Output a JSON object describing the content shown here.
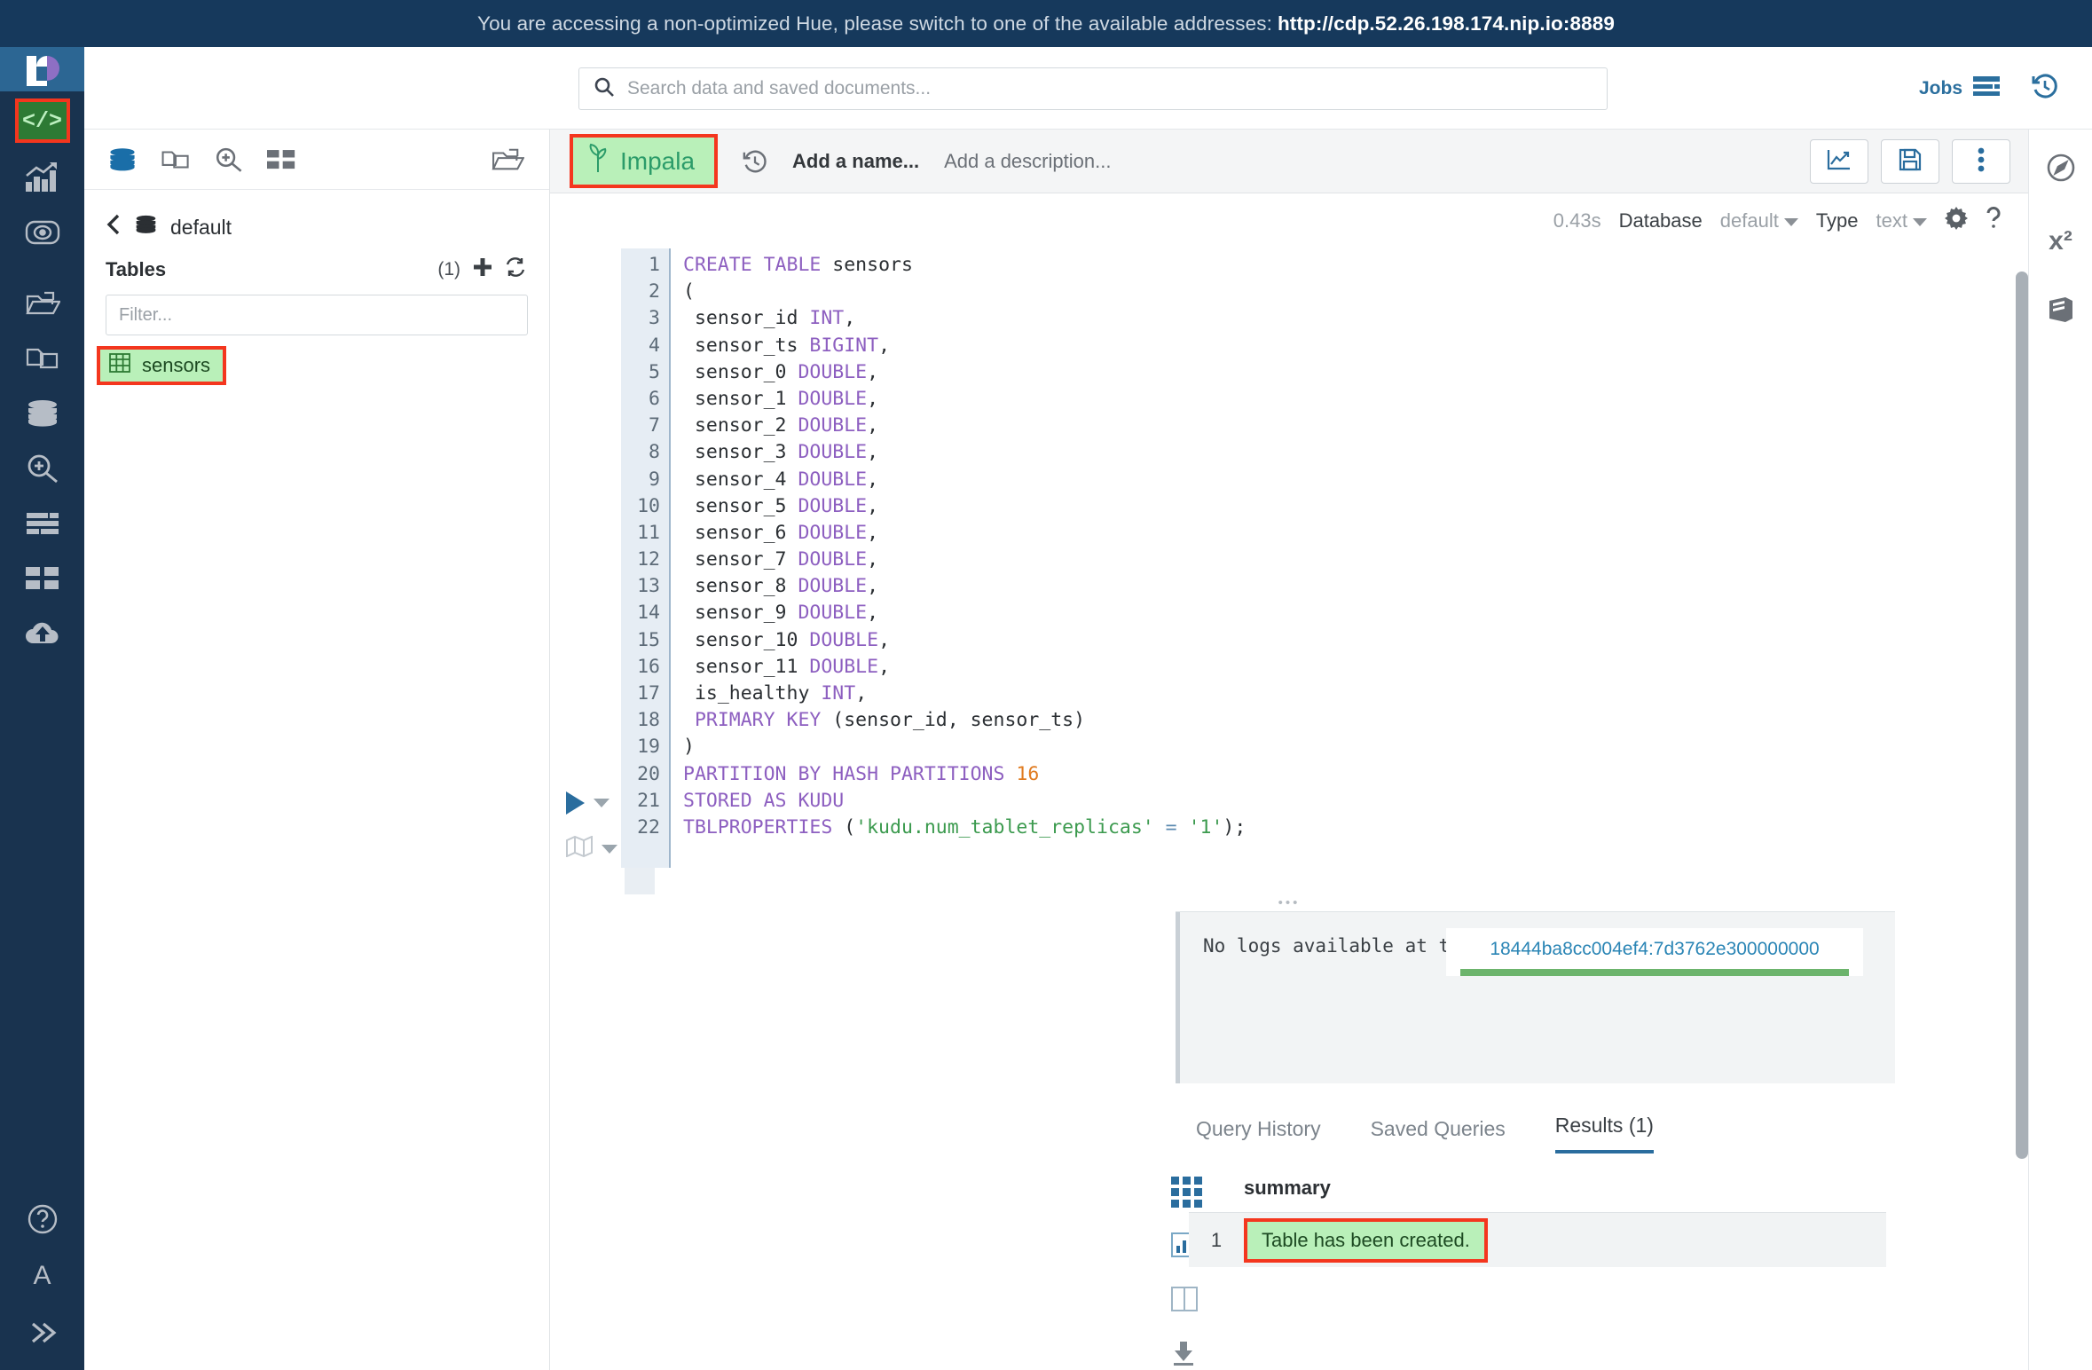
{
  "banner": {
    "message": "You are accessing a non-optimized Hue, please switch to one of the available addresses:",
    "url": "http://cdp.52.26.198.174.nip.io:8889"
  },
  "left_rail": {
    "logo": "hue-logo",
    "active_item": "</>",
    "items": [
      {
        "name": "editor",
        "icon": "code-icon",
        "label": "</>"
      },
      {
        "name": "dashboard",
        "icon": "bar-chart-trend-icon"
      },
      {
        "name": "browser",
        "icon": "oval-dot-icon"
      },
      {
        "name": "documents",
        "icon": "folder-open-icon"
      },
      {
        "name": "copy-documents",
        "icon": "copy-pages-icon"
      },
      {
        "name": "databases",
        "icon": "database-stack-icon"
      },
      {
        "name": "search-zoom",
        "icon": "zoom-in-icon"
      },
      {
        "name": "tables-list",
        "icon": "list-rows-icon"
      },
      {
        "name": "apps-grid",
        "icon": "grid-squares-icon"
      },
      {
        "name": "upload-cloud",
        "icon": "cloud-upload-icon"
      }
    ],
    "bottom_items": [
      {
        "name": "help",
        "icon": "question-circle-icon"
      },
      {
        "name": "language",
        "icon": "letter-a-icon",
        "label": "A"
      },
      {
        "name": "collapse",
        "icon": "double-chevron-right-icon"
      }
    ]
  },
  "topbar": {
    "search": {
      "icon": "search-icon",
      "placeholder": "Search data and saved documents...",
      "value": ""
    },
    "jobs_label": "Jobs",
    "jobs_icon": "jobs-list-icon",
    "history_icon": "history-clock-icon"
  },
  "assist": {
    "tabs": [
      {
        "name": "sources",
        "icon": "database-stack-icon",
        "active": true
      },
      {
        "name": "documents",
        "icon": "copy-pages-icon",
        "active": false
      },
      {
        "name": "search",
        "icon": "zoom-in-icon",
        "active": false
      },
      {
        "name": "apps",
        "icon": "grid-squares-icon",
        "active": false
      }
    ],
    "right_tab": {
      "name": "functions",
      "icon": "folder-open-icon"
    },
    "breadcrumb": {
      "back_icon": "chevron-left-icon",
      "db_icon": "database-stack-icon",
      "database": "default"
    },
    "tables_label": "Tables",
    "tables_count": "(1)",
    "add_icon": "plus-icon",
    "refresh_icon": "refresh-icon",
    "filter_placeholder": "Filter...",
    "filter_value": "",
    "tables": [
      {
        "name": "sensors",
        "icon": "table-grid-icon",
        "highlighted": true
      }
    ]
  },
  "editor": {
    "tab": {
      "label": "Impala",
      "icon": "impala-leaf-icon",
      "highlighted": true
    },
    "history_icon": "history-clock-icon",
    "name_placeholder": "Add a name...",
    "description_placeholder": "Add a description...",
    "buttons": [
      {
        "name": "chart-button",
        "icon": "line-chart-icon"
      },
      {
        "name": "save-button",
        "icon": "floppy-disk-icon"
      },
      {
        "name": "more-button",
        "icon": "vertical-dots-icon"
      }
    ],
    "meta": {
      "duration": "0.43s",
      "database_label": "Database",
      "database_value": "default",
      "type_label": "Type",
      "type_value": "text",
      "settings_icon": "gear-icon",
      "help_icon": "question-mark-icon"
    },
    "run_icon": "play-triangle-icon",
    "map_icon": "map-fold-icon",
    "code_lines": [
      {
        "n": 1,
        "tokens": [
          {
            "t": "CREATE TABLE",
            "c": "kw"
          },
          {
            "t": " sensors",
            "c": ""
          }
        ]
      },
      {
        "n": 2,
        "tokens": [
          {
            "t": "(",
            "c": ""
          }
        ]
      },
      {
        "n": 3,
        "tokens": [
          {
            "t": " sensor_id ",
            "c": ""
          },
          {
            "t": "INT",
            "c": "kw"
          },
          {
            "t": ",",
            "c": ""
          }
        ]
      },
      {
        "n": 4,
        "tokens": [
          {
            "t": " sensor_ts ",
            "c": ""
          },
          {
            "t": "BIGINT",
            "c": "kw"
          },
          {
            "t": ",",
            "c": ""
          }
        ]
      },
      {
        "n": 5,
        "tokens": [
          {
            "t": " sensor_0 ",
            "c": ""
          },
          {
            "t": "DOUBLE",
            "c": "kw"
          },
          {
            "t": ",",
            "c": ""
          }
        ]
      },
      {
        "n": 6,
        "tokens": [
          {
            "t": " sensor_1 ",
            "c": ""
          },
          {
            "t": "DOUBLE",
            "c": "kw"
          },
          {
            "t": ",",
            "c": ""
          }
        ]
      },
      {
        "n": 7,
        "tokens": [
          {
            "t": " sensor_2 ",
            "c": ""
          },
          {
            "t": "DOUBLE",
            "c": "kw"
          },
          {
            "t": ",",
            "c": ""
          }
        ]
      },
      {
        "n": 8,
        "tokens": [
          {
            "t": " sensor_3 ",
            "c": ""
          },
          {
            "t": "DOUBLE",
            "c": "kw"
          },
          {
            "t": ",",
            "c": ""
          }
        ]
      },
      {
        "n": 9,
        "tokens": [
          {
            "t": " sensor_4 ",
            "c": ""
          },
          {
            "t": "DOUBLE",
            "c": "kw"
          },
          {
            "t": ",",
            "c": ""
          }
        ]
      },
      {
        "n": 10,
        "tokens": [
          {
            "t": " sensor_5 ",
            "c": ""
          },
          {
            "t": "DOUBLE",
            "c": "kw"
          },
          {
            "t": ",",
            "c": ""
          }
        ]
      },
      {
        "n": 11,
        "tokens": [
          {
            "t": " sensor_6 ",
            "c": ""
          },
          {
            "t": "DOUBLE",
            "c": "kw"
          },
          {
            "t": ",",
            "c": ""
          }
        ]
      },
      {
        "n": 12,
        "tokens": [
          {
            "t": " sensor_7 ",
            "c": ""
          },
          {
            "t": "DOUBLE",
            "c": "kw"
          },
          {
            "t": ",",
            "c": ""
          }
        ]
      },
      {
        "n": 13,
        "tokens": [
          {
            "t": " sensor_8 ",
            "c": ""
          },
          {
            "t": "DOUBLE",
            "c": "kw"
          },
          {
            "t": ",",
            "c": ""
          }
        ]
      },
      {
        "n": 14,
        "tokens": [
          {
            "t": " sensor_9 ",
            "c": ""
          },
          {
            "t": "DOUBLE",
            "c": "kw"
          },
          {
            "t": ",",
            "c": ""
          }
        ]
      },
      {
        "n": 15,
        "tokens": [
          {
            "t": " sensor_10 ",
            "c": ""
          },
          {
            "t": "DOUBLE",
            "c": "kw"
          },
          {
            "t": ",",
            "c": ""
          }
        ]
      },
      {
        "n": 16,
        "tokens": [
          {
            "t": " sensor_11 ",
            "c": ""
          },
          {
            "t": "DOUBLE",
            "c": "kw"
          },
          {
            "t": ",",
            "c": ""
          }
        ]
      },
      {
        "n": 17,
        "tokens": [
          {
            "t": " is_healthy ",
            "c": ""
          },
          {
            "t": "INT",
            "c": "kw"
          },
          {
            "t": ",",
            "c": ""
          }
        ]
      },
      {
        "n": 18,
        "tokens": [
          {
            "t": " ",
            "c": ""
          },
          {
            "t": "PRIMARY KEY",
            "c": "kw"
          },
          {
            "t": " (sensor_id, sensor_ts)",
            "c": ""
          }
        ]
      },
      {
        "n": 19,
        "tokens": [
          {
            "t": ")",
            "c": ""
          }
        ]
      },
      {
        "n": 20,
        "tokens": [
          {
            "t": "PARTITION BY HASH PARTITIONS",
            "c": "kw"
          },
          {
            "t": " ",
            "c": ""
          },
          {
            "t": "16",
            "c": "num"
          }
        ]
      },
      {
        "n": 21,
        "tokens": [
          {
            "t": "STORED AS KUDU",
            "c": "kw"
          }
        ]
      },
      {
        "n": 22,
        "tokens": [
          {
            "t": "TBLPROPERTIES",
            "c": "kw"
          },
          {
            "t": " (",
            "c": ""
          },
          {
            "t": "'kudu.num_tablet_replicas'",
            "c": "str"
          },
          {
            "t": " ",
            "c": ""
          },
          {
            "t": "=",
            "c": "op"
          },
          {
            "t": " ",
            "c": ""
          },
          {
            "t": "'1'",
            "c": "str"
          },
          {
            "t": ");",
            "c": ""
          }
        ]
      }
    ]
  },
  "logs": {
    "message": "No logs available at this moment.",
    "query_id": "18444ba8cc004ef4:7d3762e300000000",
    "progress_color": "#6cb46c",
    "progress_percent": 100
  },
  "results": {
    "tabs": [
      {
        "label": "Query History",
        "active": false
      },
      {
        "label": "Saved Queries",
        "active": false
      },
      {
        "label": "Results (1)",
        "active": true
      }
    ],
    "rail_icons": [
      {
        "name": "grid-view-icon"
      },
      {
        "name": "chart-view-icon"
      },
      {
        "name": "columns-view-icon"
      },
      {
        "name": "download-icon"
      }
    ],
    "columns": [
      "summary"
    ],
    "rows": [
      {
        "index": "1",
        "summary": "Table has been created.",
        "highlighted": true
      }
    ]
  },
  "right_rail": {
    "items": [
      {
        "name": "assistant",
        "icon": "compass-icon"
      },
      {
        "name": "functions",
        "icon": "x-squared-icon",
        "label": "x²"
      },
      {
        "name": "docs",
        "icon": "book-icon"
      }
    ]
  },
  "colors": {
    "banner_bg": "#16395c",
    "rail_bg": "#19334f",
    "accent_blue": "#2a6d9e",
    "highlight_green": "#b9f0b9",
    "annotation_red": "#f4361e",
    "keyword_purple": "#8d5fc0",
    "string_green": "#3b9a4e",
    "number_orange": "#e07b20"
  }
}
